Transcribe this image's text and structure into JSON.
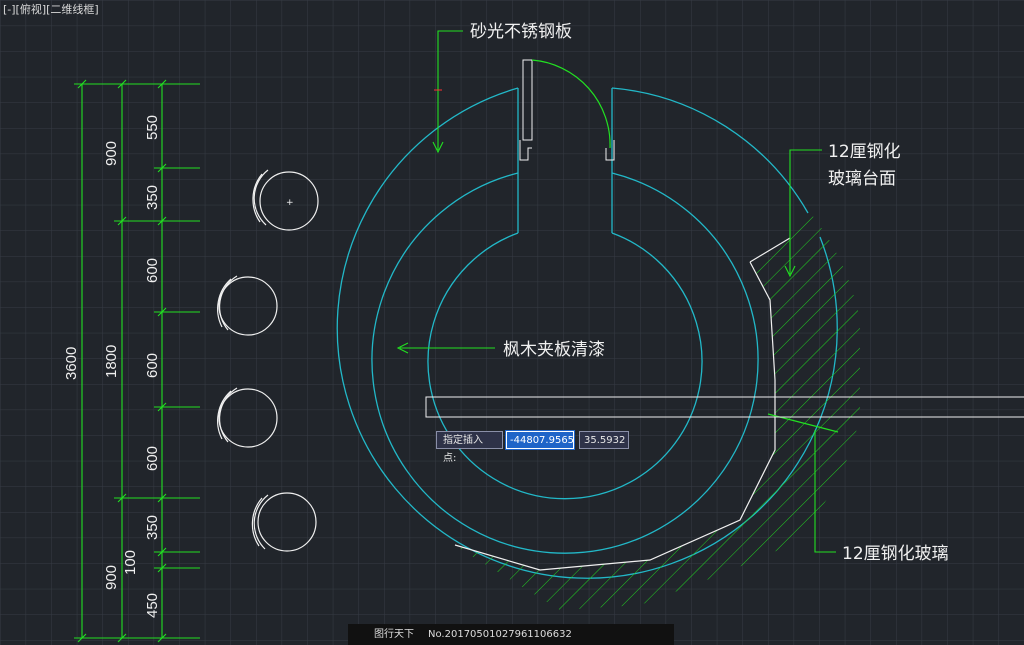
{
  "view": {
    "label": "[-][俯视][二维线框]"
  },
  "annotations": {
    "steel_plate": "砂光不锈钢板",
    "glass_top_line1": "12厘钢化",
    "glass_top_line2": "玻璃台面",
    "maple_board": "枫木夹板清漆",
    "tempered_glass": "12厘钢化玻璃"
  },
  "dimensions": {
    "total": "3600",
    "outer": [
      "900",
      "1800",
      "900"
    ],
    "middle": [
      "550",
      "350",
      "600",
      "600",
      "600",
      "350",
      "100",
      "450"
    ]
  },
  "command_prompt": {
    "label": "指定插入点:",
    "x_value": "-44807.9565",
    "y_value": "35.5932"
  },
  "watermark": {
    "site": "图行天下",
    "id": "No.20170501027961106632"
  },
  "colors": {
    "background": "#21252b",
    "grid": "#3a4048",
    "cyan_line": "#22b8c8",
    "green_line": "#22e022",
    "white_line": "#f0f0f0"
  }
}
